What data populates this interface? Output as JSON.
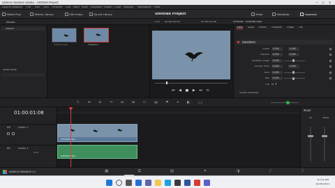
{
  "window": {
    "title": "DaVinci Resolve Studio - Untitled Project"
  },
  "menu": [
    "DaVinci Resolve",
    "File",
    "Edit",
    "Trim",
    "Timeline",
    "Clip",
    "Mark",
    "View",
    "Playback",
    "Fusion",
    "Color",
    "Fairlight",
    "Workspace",
    "Help"
  ],
  "toolbar": {
    "media_pool": "Media Pool",
    "effects_library": "Effects Library",
    "edit_index": "Edit Index",
    "sound_library": "Sound Library",
    "project_title": "Untitled Project",
    "mixer": "Mixer",
    "metadata": "Metadata",
    "inspector": "Inspector"
  },
  "media_pool": {
    "bin_master": "Master",
    "smart_bins": "Smart Bins",
    "clips": [
      {
        "label": "Untitled.mp4"
      },
      {
        "label": "Timeline 1"
      }
    ]
  },
  "viewer": {
    "zoom": "17%",
    "timecode_left": "00:00:00:00",
    "timecode_right": "00:00:01:08",
    "timeline_name": "Timeline - Untitled.mp4"
  },
  "inspector": {
    "tabs": [
      "Video",
      "Audio",
      "Effects",
      "Transition",
      "Image",
      "File"
    ],
    "section": "Transform",
    "rows": [
      {
        "label": "Zoom",
        "x": "1.000",
        "y": "1.000"
      },
      {
        "label": "Position",
        "x": "0.000",
        "y": "0.000"
      },
      {
        "label": "Rotation Angle",
        "x": "0.000",
        "y": ""
      },
      {
        "label": "Anchor Point",
        "x": "0.000",
        "y": "0.000"
      },
      {
        "label": "Pitch",
        "x": "0.000",
        "y": ""
      },
      {
        "label": "Yaw",
        "x": "0.000",
        "y": ""
      },
      {
        "label": "Flip",
        "x": "",
        "y": ""
      }
    ],
    "smart_reframe": "Smart Reframe"
  },
  "timeline": {
    "timecode": "01:00:01:08",
    "tracks": [
      {
        "id": "V1",
        "name": "Video 1",
        "clip": "Untitled.mp4"
      },
      {
        "id": "A1",
        "name": "Audio 1",
        "clip": "Untitled.mp4"
      }
    ]
  },
  "mixer": {
    "title": "Mixer",
    "channels": [
      "A1",
      "Bus1"
    ]
  },
  "bottom": {
    "app_name": "DaVinci Resolve 17"
  },
  "taskbar": {
    "time": "10:14 AM",
    "date": "10/30/2021"
  },
  "colors": {
    "accent_red": "#d8403a",
    "video_clip": "#5b7a99",
    "audio_clip": "#3f8f5d",
    "sky": "#7b93aa"
  }
}
